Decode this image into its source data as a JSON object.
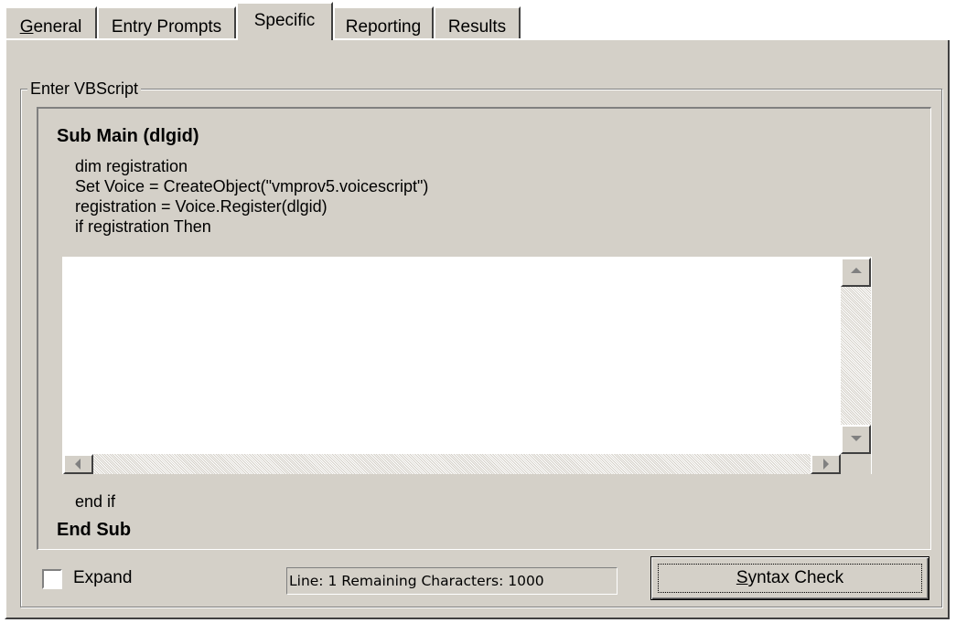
{
  "tabs": [
    {
      "label": "General",
      "mnemonic": "G",
      "rest": "eneral"
    },
    {
      "label": "Entry Prompts"
    },
    {
      "label": "Specific",
      "active": true
    },
    {
      "label": "Reporting"
    },
    {
      "label": "Results"
    }
  ],
  "group": {
    "label": "Enter VBScript"
  },
  "script": {
    "header": "Sub Main (dlgid)",
    "lines": [
      "dim registration",
      "Set Voice = CreateObject(\"vmprov5.voicescript\")",
      "registration = Voice.Register(dlgid)",
      "if registration Then"
    ],
    "editor_value": "",
    "after_line": "end if",
    "footer": "End Sub"
  },
  "expand": {
    "label": "Expand",
    "checked": false
  },
  "status": {
    "text": "Line: 1   Remaining Characters: 1000"
  },
  "syntax_button": {
    "label": "Syntax Check",
    "mnemonic": "S",
    "rest": "yntax Check"
  },
  "icons": {
    "scroll_up": "triangle-up-icon",
    "scroll_down": "triangle-down-icon",
    "scroll_left": "triangle-left-icon",
    "scroll_right": "triangle-right-icon"
  }
}
